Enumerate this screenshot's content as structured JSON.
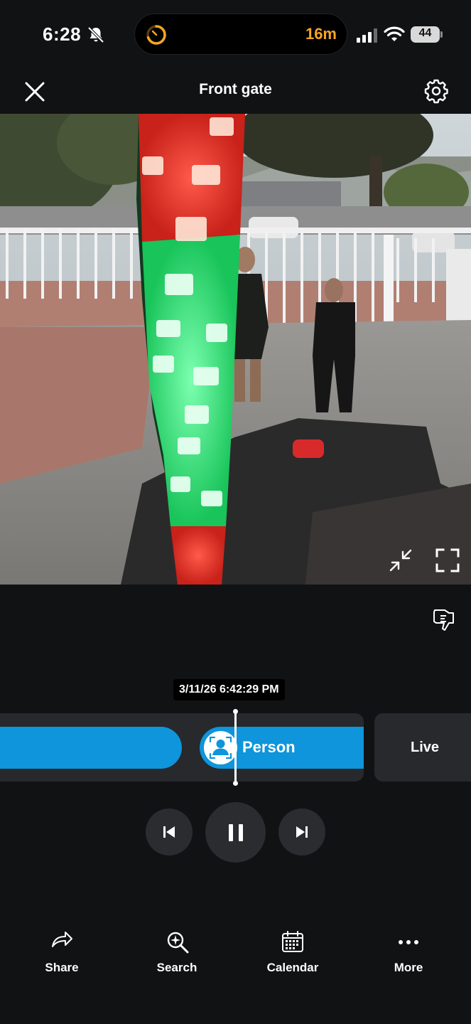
{
  "status_bar": {
    "time": "6:28",
    "island_timer": "16m",
    "battery": "44"
  },
  "header": {
    "title": "Front gate"
  },
  "timeline": {
    "timestamp": "3/11/26 6:42:29 PM",
    "event_label": "Person",
    "live_label": "Live"
  },
  "bottom_nav": {
    "share": "Share",
    "search": "Search",
    "calendar": "Calendar",
    "more": "More"
  },
  "colors": {
    "accent_blue": "#0e95db",
    "timer_orange": "#f5a623",
    "background": "#111214"
  }
}
